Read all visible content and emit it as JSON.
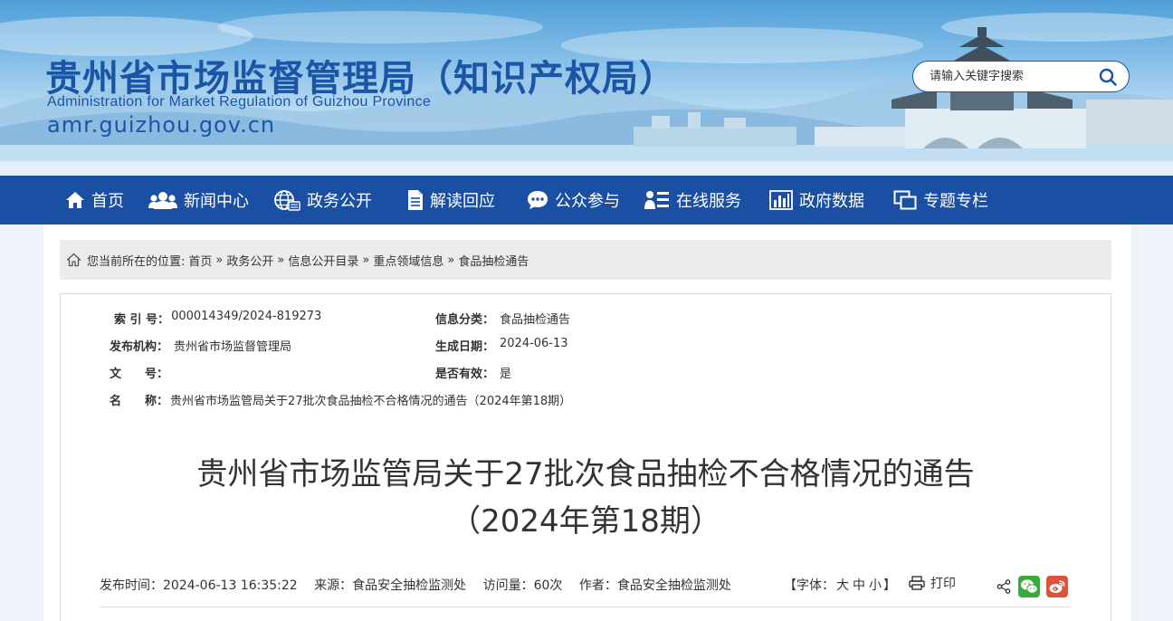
{
  "header": {
    "title": "贵州省市场监督管理局（知识产权局）",
    "subtitle": "Administration for Market Regulation of Guizhou Province",
    "url": "amr.guizhou.gov.cn"
  },
  "search": {
    "placeholder": "请输入关键字搜索",
    "icon": "search-icon"
  },
  "nav": {
    "items": [
      {
        "label": "首页",
        "icon": "home-icon"
      },
      {
        "label": "新闻中心",
        "icon": "people-icon"
      },
      {
        "label": "政务公开",
        "icon": "globe-icon"
      },
      {
        "label": "解读回应",
        "icon": "document-icon"
      },
      {
        "label": "公众参与",
        "icon": "chat-icon"
      },
      {
        "label": "在线服务",
        "icon": "list-icon"
      },
      {
        "label": "政府数据",
        "icon": "bar-chart-icon"
      },
      {
        "label": "专题专栏",
        "icon": "windows-icon"
      }
    ]
  },
  "breadcrumb": {
    "prefix": "您当前所在的位置:",
    "items": [
      "首页",
      "政务公开",
      "信息公开目录",
      "重点领域信息",
      "食品抽检通告"
    ],
    "separator": "»"
  },
  "meta": {
    "index_label": "索 引 号：",
    "index_value": "000014349/2024-819273",
    "category_label": "信息分类：",
    "category_value": "食品抽检通告",
    "publisher_label": "发布机构：",
    "publisher_value": "贵州省市场监督管理局",
    "date_label": "生成日期：",
    "date_value": "2024-06-13",
    "docno_label": "文　　号：",
    "docno_value": "",
    "valid_label": "是否有效：",
    "valid_value": "是",
    "name_label": "名　　称：",
    "name_value": "贵州省市场监管局关于27批次食品抽检不合格情况的通告（2024年第18期）"
  },
  "article": {
    "title_line1": "贵州省市场监管局关于27批次食品抽检不合格情况的通告",
    "title_line2": "（2024年第18期）",
    "publish_time": "发布时间：2024-06-13 16:35:22",
    "source": "来源：食品安全抽检监测处",
    "views": "访问量：60次",
    "author": "作者：食品安全抽检监测处"
  },
  "tools": {
    "font_prefix": "【字体：",
    "font_large": "大",
    "font_medium": "中",
    "font_small": "小",
    "font_suffix": "】",
    "print_label": "打印",
    "share_icons": [
      "share-icon",
      "wechat-icon",
      "weibo-icon"
    ]
  },
  "colors": {
    "brand_blue": "#1a4fa3",
    "title_blue": "#1b55a5",
    "wechat_green": "#3aa83a",
    "weibo_red": "#e0513a"
  }
}
